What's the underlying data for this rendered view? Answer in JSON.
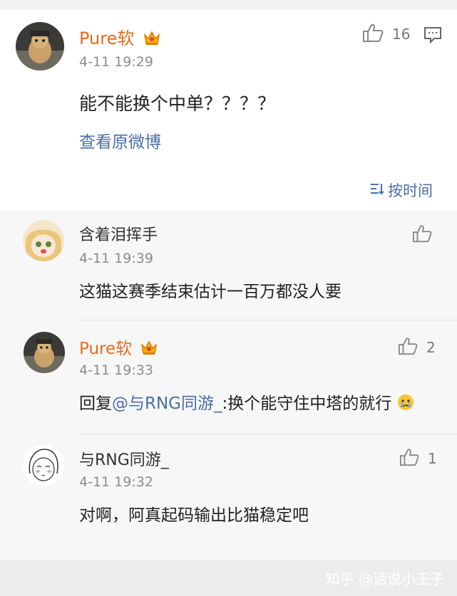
{
  "main": {
    "user": "Pure软",
    "time": "4-11 19:29",
    "likes": "16",
    "text": "能不能换个中单？？？？",
    "view_original": "查看原微博",
    "sort_label": "按时间"
  },
  "replies": [
    {
      "user": "含着泪挥手",
      "time": "4-11 19:39",
      "likes": "",
      "text": "这猫这赛季结束估计一百万都没人要"
    },
    {
      "user": "Pure软",
      "time": "4-11 19:33",
      "likes": "2",
      "text_prefix": "回复",
      "mention": "@与RNG同游_",
      "text_suffix": ":换个能守住中塔的就行"
    },
    {
      "user": "与RNG同游_",
      "time": "4-11 19:32",
      "likes": "1",
      "text": "对啊，阿真起码输出比猫稳定吧"
    }
  ],
  "watermark": "知乎 @话说小王子",
  "colors": {
    "username": "#e86b1c",
    "link": "#4a6fa5",
    "time": "#8c8c8c"
  }
}
